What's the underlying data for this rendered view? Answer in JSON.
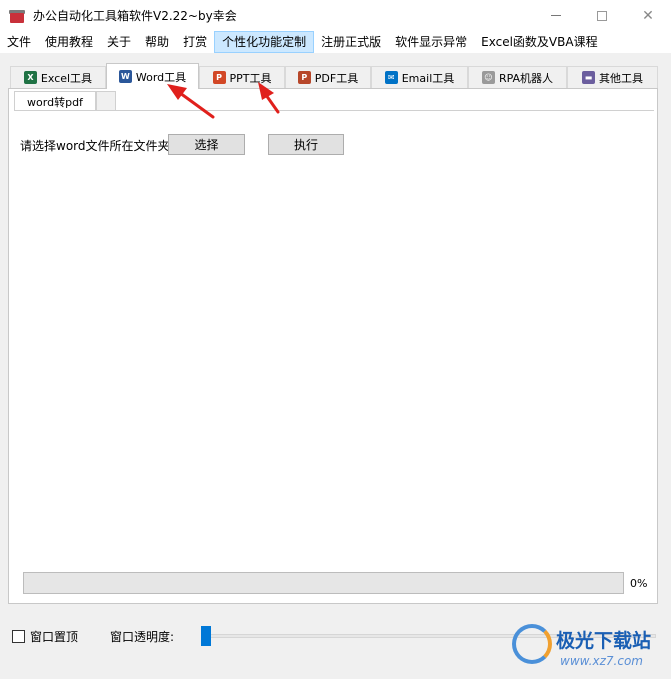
{
  "window": {
    "title": "办公自动化工具箱软件V2.22~by幸会",
    "icon": "toolbox-icon"
  },
  "menu": [
    {
      "label": "文件"
    },
    {
      "label": "使用教程"
    },
    {
      "label": "关于"
    },
    {
      "label": "帮助"
    },
    {
      "label": "打赏"
    },
    {
      "label": "个性化功能定制"
    },
    {
      "label": "注册正式版"
    },
    {
      "label": "软件显示异常"
    },
    {
      "label": "Excel函数及VBA课程"
    }
  ],
  "tabs": [
    {
      "label": "Excel工具",
      "icon": "excel-icon",
      "color": "#1f7244"
    },
    {
      "label": "Word工具",
      "icon": "word-icon",
      "color": "#2b579a"
    },
    {
      "label": "PPT工具",
      "icon": "ppt-icon",
      "color": "#d24726"
    },
    {
      "label": "PDF工具",
      "icon": "pdf-icon",
      "color": "#b7472a"
    },
    {
      "label": "Email工具",
      "icon": "email-icon",
      "color": "#0072c6"
    },
    {
      "label": "RPA机器人",
      "icon": "robot-icon",
      "color": "#888888"
    },
    {
      "label": "其他工具",
      "icon": "folder-icon",
      "color": "#6b5e9e"
    }
  ],
  "active_tab": "Word工具",
  "subtabs": [
    {
      "label": "word转pdf"
    }
  ],
  "form": {
    "folder_label": "请选择word文件所在文件夹:",
    "select_button": "选择",
    "run_button": "执行"
  },
  "progress": {
    "value": 0,
    "text": "0%"
  },
  "bottom": {
    "topmost_label": "窗口置顶",
    "topmost_checked": false,
    "opacity_label": "窗口透明度:",
    "opacity_value": 0
  },
  "watermark": {
    "text": "极光下载站",
    "url": "www.xz7.com"
  },
  "colors": {
    "accent": "#0078d7",
    "annotation": "#e0201c"
  }
}
